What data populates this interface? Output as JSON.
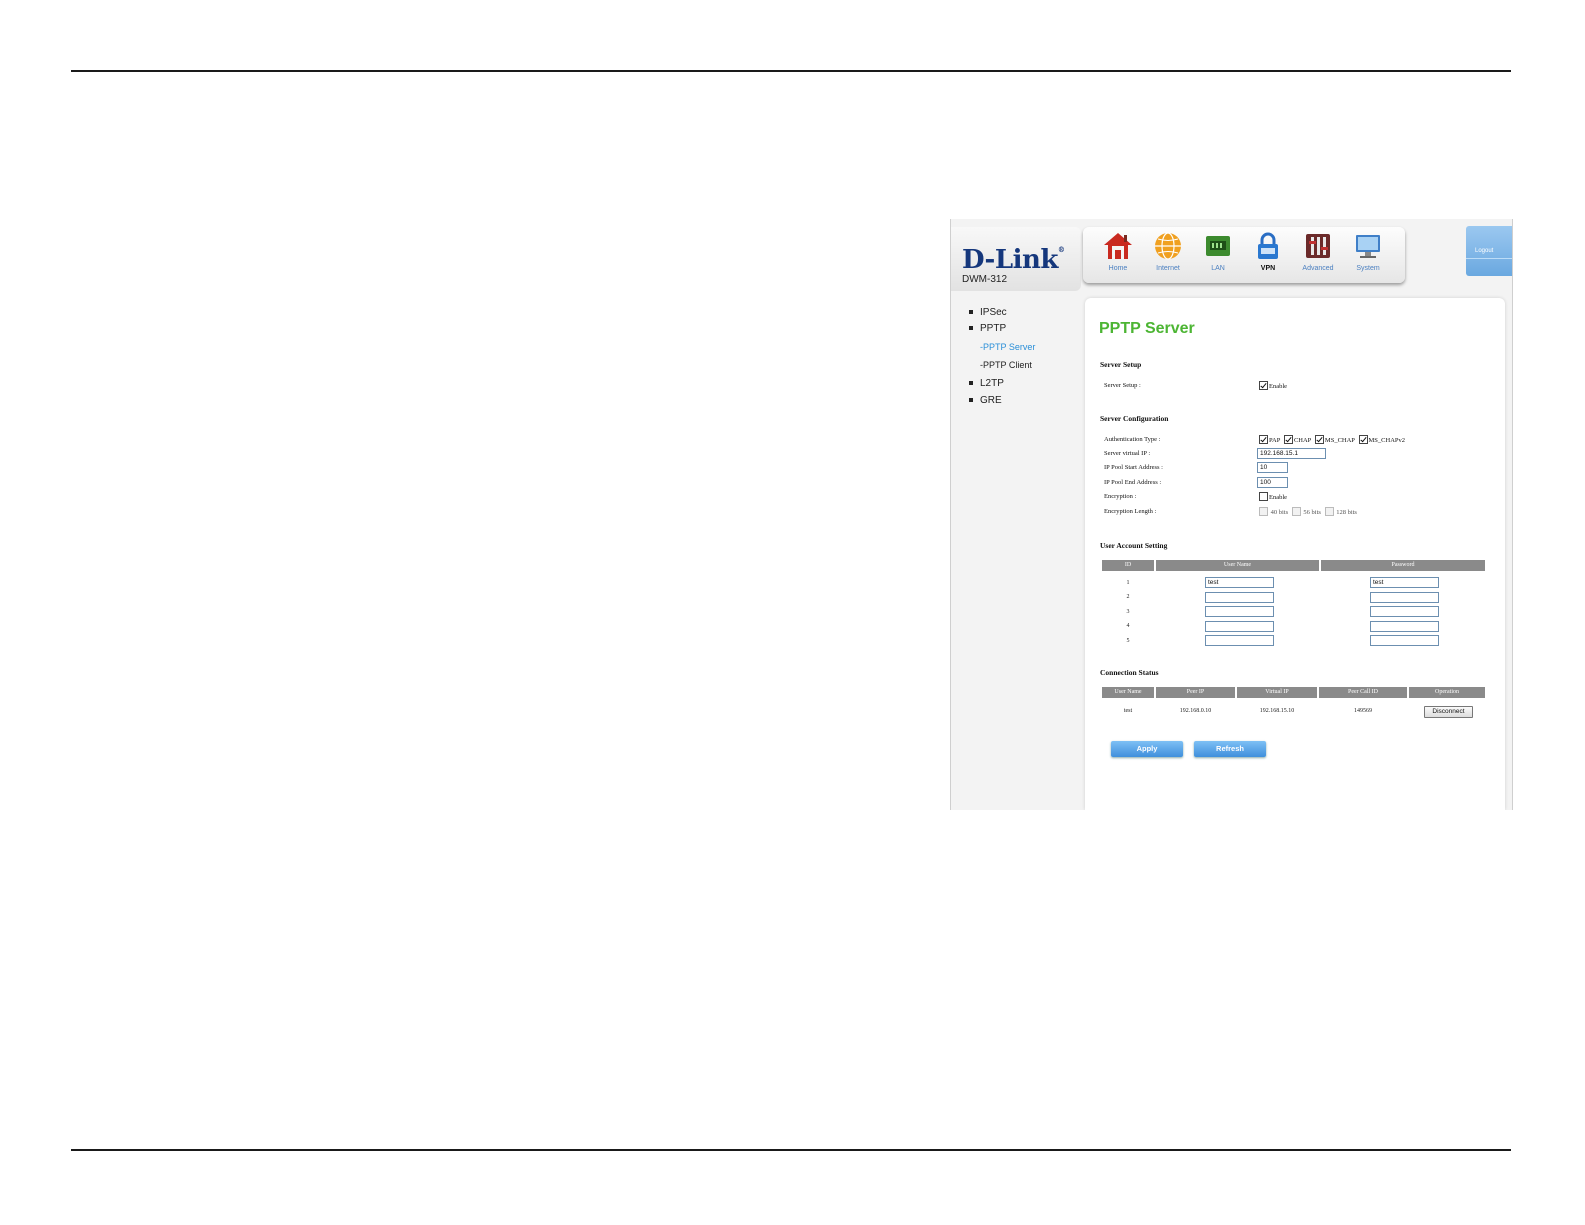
{
  "brand": {
    "logo": "D-Link",
    "model": "DWM-312"
  },
  "nav": {
    "items": [
      {
        "label": "Home",
        "icon": "home-icon"
      },
      {
        "label": "Internet",
        "icon": "globe-icon"
      },
      {
        "label": "LAN",
        "icon": "lan-icon"
      },
      {
        "label": "VPN",
        "icon": "vpn-lock-icon"
      },
      {
        "label": "Advanced",
        "icon": "tools-icon"
      },
      {
        "label": "System",
        "icon": "monitor-icon"
      }
    ],
    "active": "VPN",
    "logout": "Logout"
  },
  "sidebar": {
    "items": [
      {
        "label": "IPSec"
      },
      {
        "label": "PPTP"
      },
      {
        "label": "-PPTP Server"
      },
      {
        "label": "-PPTP Client"
      },
      {
        "label": "L2TP"
      },
      {
        "label": "GRE"
      }
    ],
    "active": "-PPTP Server"
  },
  "page": {
    "title": "PPTP Server",
    "server_setup": {
      "section": "Server Setup",
      "label": "Server Setup :",
      "enable_label": "Enable",
      "enabled": true
    },
    "server_config": {
      "section": "Server Configuration",
      "auth_label": "Authentication Type :",
      "auth_options": [
        {
          "label": "PAP",
          "checked": true
        },
        {
          "label": "CHAP",
          "checked": true
        },
        {
          "label": "MS_CHAP",
          "checked": true
        },
        {
          "label": "MS_CHAPv2",
          "checked": true
        }
      ],
      "virtual_ip_label": "Server virtual IP :",
      "virtual_ip": "192.168.15.1",
      "pool_start_label": "IP Pool Start Address :",
      "pool_start": "10",
      "pool_end_label": "IP Pool End Address :",
      "pool_end": "100",
      "encryption_label": "Encryption :",
      "encryption_enable": "Enable",
      "encryption_enabled": false,
      "enc_length_label": "Encryption Length :",
      "enc_lengths": [
        "40 bits",
        "56 bits",
        "128 bits"
      ]
    },
    "user_accounts": {
      "section": "User Account Setting",
      "headers": [
        "ID",
        "User Name",
        "Password"
      ],
      "rows": [
        {
          "id": "1",
          "user": "test",
          "pass": "test"
        },
        {
          "id": "2",
          "user": "",
          "pass": ""
        },
        {
          "id": "3",
          "user": "",
          "pass": ""
        },
        {
          "id": "4",
          "user": "",
          "pass": ""
        },
        {
          "id": "5",
          "user": "",
          "pass": ""
        }
      ]
    },
    "connection_status": {
      "section": "Connection Status",
      "headers": [
        "User Name",
        "Peer IP",
        "Virtual IP",
        "Peer Call ID",
        "Operation"
      ],
      "rows": [
        {
          "user": "test",
          "peer_ip": "192.168.0.10",
          "virtual_ip": "192.168.15.10",
          "call_id": "149569",
          "op": "Disconnect"
        }
      ]
    },
    "buttons": {
      "apply": "Apply",
      "refresh": "Refresh"
    }
  },
  "colors": {
    "title_green": "#4cb533",
    "link_blue": "#2a8fd8",
    "logo_blue": "#15377c",
    "header_gray": "#8a8a8a"
  }
}
